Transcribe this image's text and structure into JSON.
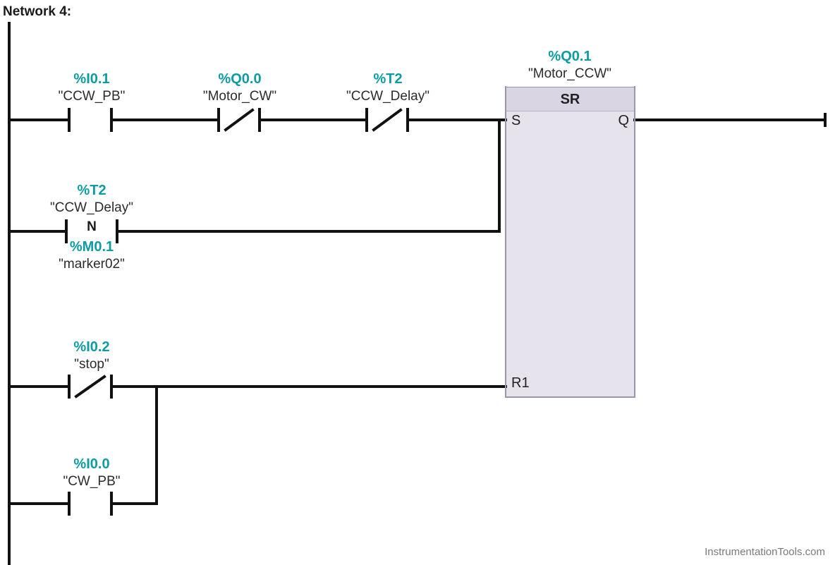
{
  "network_title": "Network 4:",
  "watermark": "InstrumentationTools.com",
  "sr_block": {
    "addr": "%Q0.1",
    "sym": "\"Motor_CCW\"",
    "title": "SR",
    "pin_s": "S",
    "pin_q": "Q",
    "pin_r": "R1"
  },
  "contacts": {
    "ccw_pb": {
      "addr": "%I0.1",
      "sym": "\"CCW_PB\""
    },
    "motor_cw": {
      "addr": "%Q0.0",
      "sym": "\"Motor_CW\""
    },
    "ccw_delay": {
      "addr": "%T2",
      "sym": "\"CCW_Delay\""
    },
    "t2_edge": {
      "addr": "%T2",
      "sym": "\"CCW_Delay\"",
      "edge": "N"
    },
    "marker02": {
      "addr": "%M0.1",
      "sym": "\"marker02\""
    },
    "stop": {
      "addr": "%I0.2",
      "sym": "\"stop\""
    },
    "cw_pb": {
      "addr": "%I0.0",
      "sym": "\"CW_PB\""
    }
  }
}
